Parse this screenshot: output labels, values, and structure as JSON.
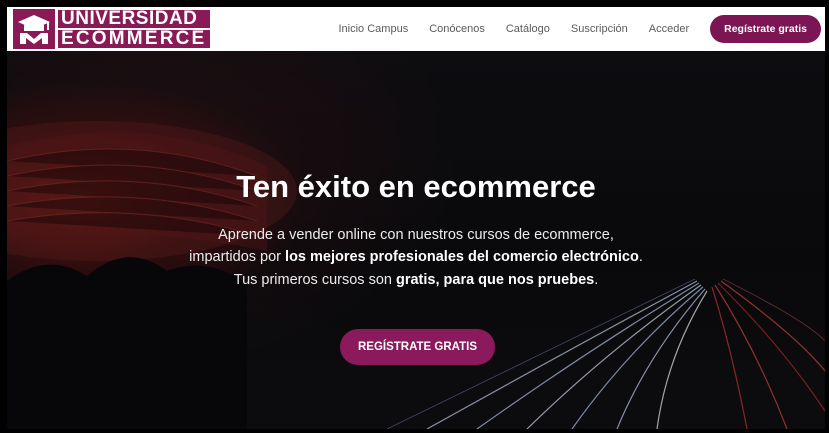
{
  "brand": {
    "line1": "UNIVERSIDAD",
    "line2": "ECOMMERCE",
    "color": "#8a1a55",
    "icon": "graduation-cap-icon"
  },
  "nav": {
    "items": [
      {
        "label": "Inicio Campus"
      },
      {
        "label": "Conócenos"
      },
      {
        "label": "Catálogo"
      },
      {
        "label": "Suscripción"
      },
      {
        "label": "Acceder"
      }
    ],
    "cta_label": "Regístrate gratis",
    "cta_color": "#7c1553"
  },
  "hero": {
    "title": "Ten éxito en ecommerce",
    "line1": "Aprende a vender online con nuestros cursos de ecommerce,",
    "line2_prefix": "impartidos por ",
    "line2_bold": "los mejores profesionales del comercio electrónico",
    "line2_suffix": ".",
    "line3_prefix": "Tus primeros cursos son ",
    "line3_bold": "gratis, para que nos pruebes",
    "line3_suffix": ".",
    "cta_label": "REGÍSTRATE GRATIS",
    "cta_color": "#8b1a5d"
  }
}
